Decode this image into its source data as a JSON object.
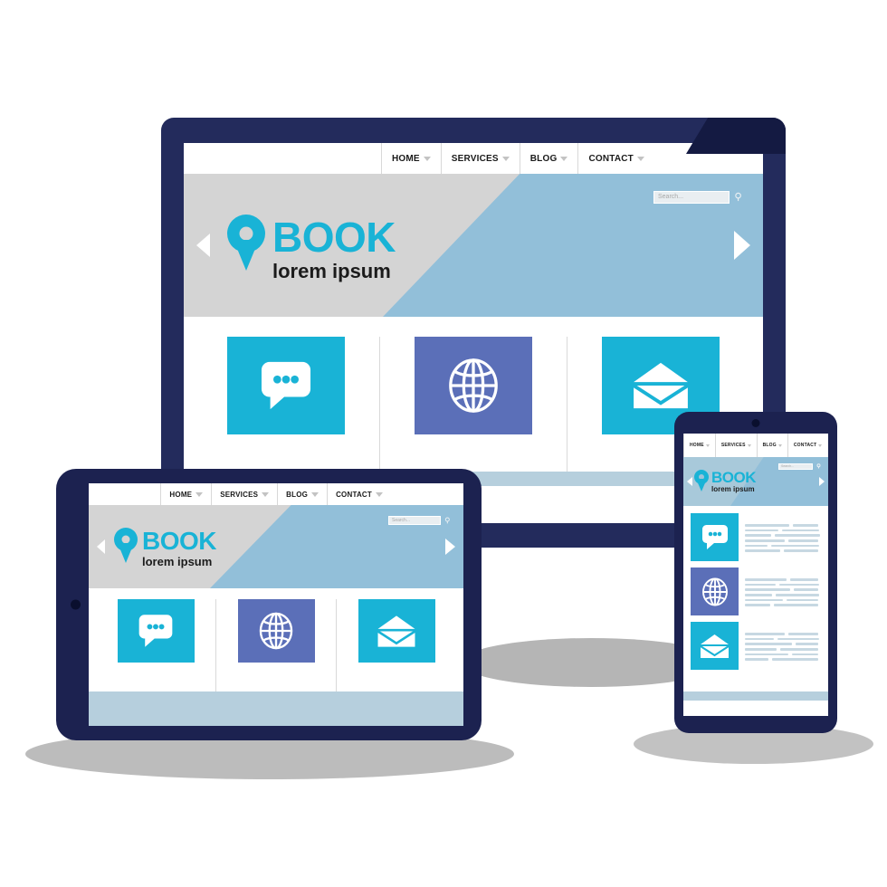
{
  "brand": {
    "title": "BOOK",
    "tagline": "lorem ipsum",
    "pin_icon": "map-pin-icon",
    "accent_color": "#19b3d6",
    "dark_color": "#1b1b1b"
  },
  "nav": {
    "items": [
      {
        "label": "HOME",
        "caret": "chevron-down-icon"
      },
      {
        "label": "SERVICES",
        "caret": "chevron-down-icon"
      },
      {
        "label": "BLOG",
        "caret": "chevron-down-icon"
      },
      {
        "label": "CONTACT",
        "caret": "chevron-down-icon"
      }
    ]
  },
  "search": {
    "placeholder": "Search...",
    "value": "",
    "icon": "search-icon"
  },
  "carousel": {
    "prev_icon": "arrow-left-icon",
    "next_icon": "arrow-right-icon"
  },
  "cards": [
    {
      "icon": "chat-bubble-icon",
      "color": "#19b3d6"
    },
    {
      "icon": "globe-icon",
      "color": "#5b6fb8"
    },
    {
      "icon": "envelope-icon",
      "color": "#19b3d6"
    }
  ],
  "devices": {
    "monitor": {
      "name": "desktop-monitor",
      "frame_color": "#232b5c"
    },
    "tablet": {
      "name": "tablet-device",
      "frame_color": "#1c2250"
    },
    "phone": {
      "name": "smartphone-device",
      "frame_color": "#1c2250"
    }
  },
  "palette": {
    "navy": "#232b5c",
    "cyan": "#19b3d6",
    "purple": "#5b6fb8",
    "hero_gray": "#d4d4d4",
    "hero_blue": "#92bfd9",
    "footer_blue": "#b6cfdd",
    "shadow_gray": "#b9b9b9",
    "page_background": "#ffffff"
  }
}
